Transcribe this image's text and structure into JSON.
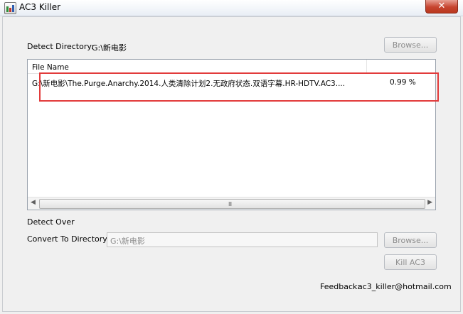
{
  "window": {
    "title": "AC3 Killer",
    "close_glyph": "✕"
  },
  "detect": {
    "label": "Detect Directory:",
    "value": "G:\\新电影",
    "browse_label": "Browse..."
  },
  "list": {
    "column_file": "File Name",
    "rows": [
      {
        "file": "G:\\新电影\\The.Purge.Anarchy.2014.人类清除计划2.无政府状态.双语字幕.HR-HDTV.AC3....",
        "progress": "0.99 %"
      }
    ],
    "grip": "III"
  },
  "status": {
    "text": "Detect Over"
  },
  "convert": {
    "label": "Convert To Directory:",
    "value": "G:\\新电影",
    "browse_label": "Browse..."
  },
  "kill": {
    "label": "Kill AC3"
  },
  "feedback": {
    "label": "Feedback:",
    "email": "ac3_killer@hotmail.com"
  },
  "colors": {
    "highlight": "#e23b3b",
    "close": "#c7442f"
  }
}
